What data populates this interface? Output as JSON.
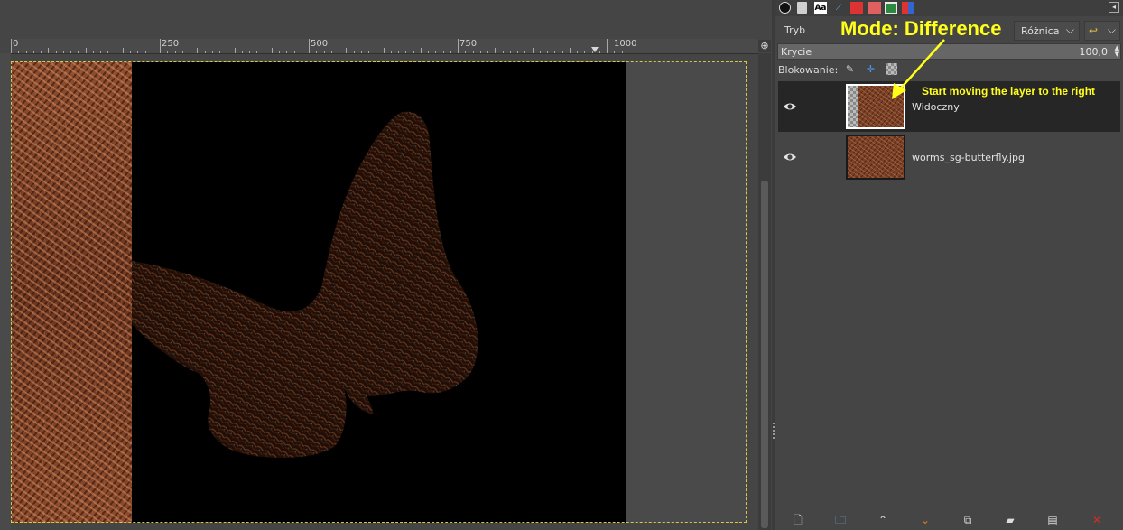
{
  "ruler": {
    "labels": [
      "0",
      "250",
      "500",
      "750",
      "1000"
    ]
  },
  "canvas": {
    "nav_glyph": "⊕",
    "frame_color": "#d8c84a"
  },
  "dock": {
    "tab_icons": [
      "brush-tab-icon",
      "pattern-tab-icon",
      "font-tab-icon",
      "path-tab-icon",
      "tool-tab-icon",
      "color-tab-icon",
      "layers-tab-icon",
      "channels-tab-icon"
    ],
    "mode": {
      "label": "Tryb",
      "value": "Różnica",
      "chevron": "⌵"
    },
    "opacity": {
      "label": "Krycie",
      "value": "100,0",
      "fraction": 1.0
    },
    "lock": {
      "label": "Blokowanie:",
      "pixels_glyph": "✎",
      "position_glyph": "✛"
    },
    "layers": [
      {
        "name": "Widoczny",
        "selected": true
      },
      {
        "name": "worms_sg-butterfly.jpg",
        "selected": false
      }
    ],
    "bottom_buttons": [
      {
        "name": "new-layer-button",
        "glyph": "🗋"
      },
      {
        "name": "new-group-button",
        "glyph": "🗀"
      },
      {
        "name": "raise-layer-button",
        "glyph": "⌃"
      },
      {
        "name": "lower-layer-button",
        "glyph": "⌄"
      },
      {
        "name": "duplicate-layer-button",
        "glyph": "⧉"
      },
      {
        "name": "anchor-layer-button",
        "glyph": "▰"
      },
      {
        "name": "layer-mask-button",
        "glyph": "▤"
      },
      {
        "name": "delete-layer-button",
        "glyph": "✕"
      }
    ]
  },
  "annotations": {
    "mode_note": "Mode: Difference",
    "move_note": "Start moving the layer to the right",
    "color": "#ffff1a"
  },
  "colors": {
    "texture": "#7a4126",
    "background": "#454545",
    "selected_row": "#262626",
    "delete": "#d62a2a",
    "lower_arrow": "#e07b1a"
  }
}
